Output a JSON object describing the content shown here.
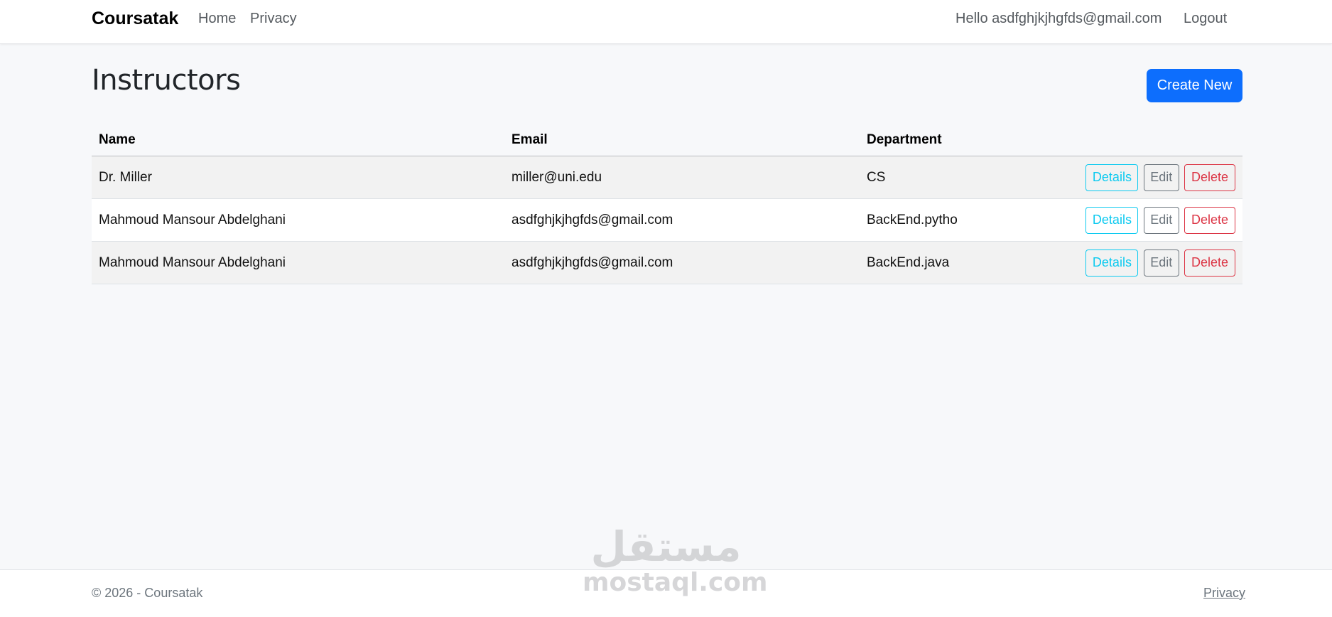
{
  "navbar": {
    "brand": "Coursatak",
    "home": "Home",
    "privacy": "Privacy",
    "hello": "Hello asdfghjkjhgfds@gmail.com",
    "logout": "Logout"
  },
  "page": {
    "title": "Instructors",
    "create_new": "Create New"
  },
  "table": {
    "headers": {
      "name": "Name",
      "email": "Email",
      "department": "Department"
    },
    "rows": [
      {
        "name": "Dr. Miller",
        "email": "miller@uni.edu",
        "department": "CS"
      },
      {
        "name": "Mahmoud Mansour Abdelghani",
        "email": "asdfghjkjhgfds@gmail.com",
        "department": "BackEnd.pytho"
      },
      {
        "name": "Mahmoud Mansour Abdelghani",
        "email": "asdfghjkjhgfds@gmail.com",
        "department": "BackEnd.java"
      }
    ],
    "actions": {
      "details": "Details",
      "edit": "Edit",
      "delete": "Delete"
    }
  },
  "footer": {
    "copyright": "© 2026 - Coursatak",
    "privacy": "Privacy"
  },
  "watermark": {
    "arabic": "مستقل",
    "latin": "mostaql.com"
  },
  "colors": {
    "primary": "#0d6efd",
    "info": "#0dcaf0",
    "secondary": "#6c757d",
    "danger": "#dc3545"
  }
}
